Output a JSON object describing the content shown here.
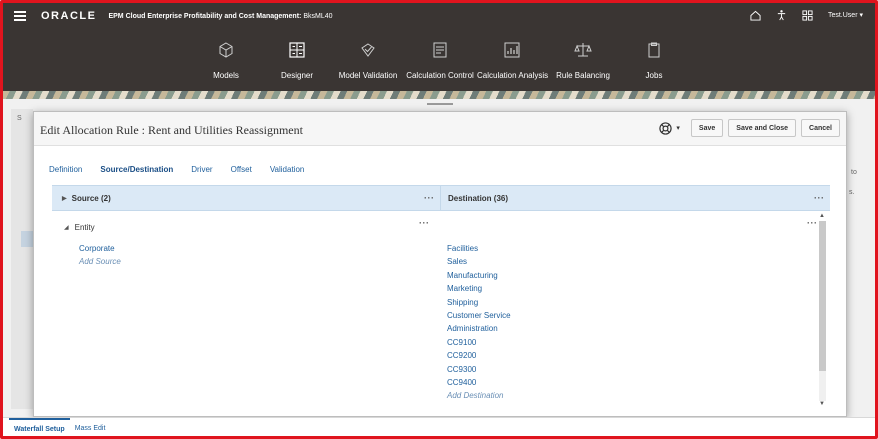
{
  "header": {
    "logo": "ORACLE",
    "app_title": "EPM Cloud Enterprise Profitability and Cost Management:",
    "environment": "BksML40",
    "user": "Test.User",
    "user_caret": "▾",
    "icons": [
      "hamburger-icon",
      "home-icon",
      "accessibility-icon",
      "apps-grid-icon"
    ]
  },
  "nav": {
    "items": [
      {
        "label": "Models",
        "icon": "cube-icon"
      },
      {
        "label": "Designer",
        "icon": "designer-icon"
      },
      {
        "label": "Model Validation",
        "icon": "model-validation-icon"
      },
      {
        "label": "Calculation Control",
        "icon": "calculation-control-icon"
      },
      {
        "label": "Calculation Analysis",
        "icon": "calculation-analysis-icon"
      },
      {
        "label": "Rule Balancing",
        "icon": "scale-icon"
      },
      {
        "label": "Jobs",
        "icon": "clipboard-icon"
      }
    ]
  },
  "background": {
    "left_letter": "S",
    "right_text_1": "to",
    "right_text_2": "s."
  },
  "dialog": {
    "title": "Edit Allocation Rule : Rent and Utilities Reassignment",
    "help_caret": "▾",
    "buttons": {
      "save": "Save",
      "save_and_close": "Save and Close",
      "cancel": "Cancel"
    },
    "tabs": [
      "Definition",
      "Source/Destination",
      "Driver",
      "Offset",
      "Validation"
    ],
    "active_tab": "Source/Destination",
    "source_header": "Source (2)",
    "destination_header": "Destination (36)",
    "more_label": "···",
    "expand_glyph": "▶",
    "collapse_glyph": "◢",
    "scroll_up": "▲",
    "scroll_down": "▼",
    "entity_label": "Entity",
    "source_items": [
      "Corporate"
    ],
    "add_source": "Add Source",
    "destination_items": [
      "Facilities",
      "Sales",
      "Manufacturing",
      "Marketing",
      "Shipping",
      "Customer Service",
      "Administration",
      "CC9100",
      "CC9200",
      "CC9300",
      "CC9400"
    ],
    "add_destination": "Add Destination"
  },
  "bottom_tabs": [
    "Waterfall Setup",
    "Mass Edit"
  ],
  "colors": {
    "header_bg": "#3a3533",
    "accent_link": "#1f5f9c",
    "column_header_bg": "#dbe9f6",
    "frame_border": "#e0141e"
  }
}
